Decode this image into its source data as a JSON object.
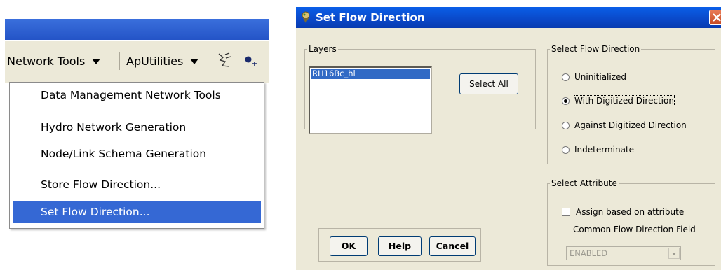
{
  "toolbar": {
    "network_tools_label": "Network Tools",
    "aputilities_label": "ApUtilities"
  },
  "menu": {
    "items": [
      {
        "label": "Data Management Network Tools"
      },
      {
        "label": "Hydro Network Generation"
      },
      {
        "label": "Node/Link Schema Generation"
      },
      {
        "label": "Store Flow Direction..."
      },
      {
        "label": "Set Flow Direction..."
      }
    ],
    "selected_item": "Set Flow Direction..."
  },
  "dialog": {
    "title": "Set Flow Direction",
    "layers": {
      "legend": "Layers",
      "items": [
        "RH16Bc_hl"
      ],
      "select_all_label": "Select All"
    },
    "flow_direction": {
      "legend": "Select Flow Direction",
      "options": [
        {
          "label": "Uninitialized",
          "selected": false
        },
        {
          "label": "With Digitized Direction",
          "selected": true
        },
        {
          "label": "Against Digitized Direction",
          "selected": false
        },
        {
          "label": "Indeterminate",
          "selected": false
        }
      ]
    },
    "attribute": {
      "legend": "Select Attribute",
      "checkbox_label": "Assign based on attribute",
      "checked": false,
      "field_label": "Common Flow Direction Field",
      "field_value": "ENABLED"
    },
    "buttons": {
      "ok": "OK",
      "help": "Help",
      "cancel": "Cancel"
    }
  },
  "colors": {
    "selection_blue": "#3568d4",
    "title_bar_blue": "#0a5fe8",
    "dialog_face": "#ece9d8"
  },
  "icons": [
    "dropdown-arrow-icon",
    "network-tool-icon",
    "add-node-icon",
    "app-icon",
    "close-icon"
  ]
}
